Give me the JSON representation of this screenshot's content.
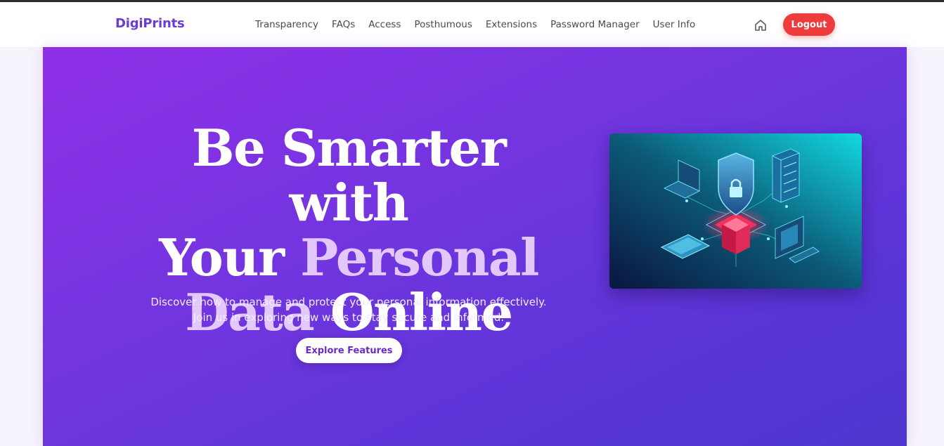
{
  "brand": {
    "name": "DigiPrints",
    "color": "#6a3bd8"
  },
  "nav": {
    "links": [
      {
        "label": "Transparency"
      },
      {
        "label": "FAQs"
      },
      {
        "label": "Access"
      },
      {
        "label": "Posthumous"
      },
      {
        "label": "Extensions"
      },
      {
        "label": "Password Manager"
      },
      {
        "label": "User Info"
      }
    ],
    "home_icon": "home-icon",
    "logout_label": "Logout"
  },
  "hero": {
    "headline_line1": "Be Smarter with",
    "headline_line2_a": "Your ",
    "headline_line2_b": "Personal",
    "headline_line3_a": "Data",
    "headline_line3_b": " Online",
    "subtitle": "Discover how to manage and protect your personal information effectively. Join us in exploring new ways to stay secure and informed.",
    "cta_label": "Explore Features",
    "image_subject": "isometric-cyber-security-illustration"
  },
  "colors": {
    "accent_logout": "#ee3b3b",
    "hero_gradient_start": "#9030e8",
    "hero_gradient_end": "#4f37cf",
    "headline_highlight": "#e3c8fb"
  }
}
